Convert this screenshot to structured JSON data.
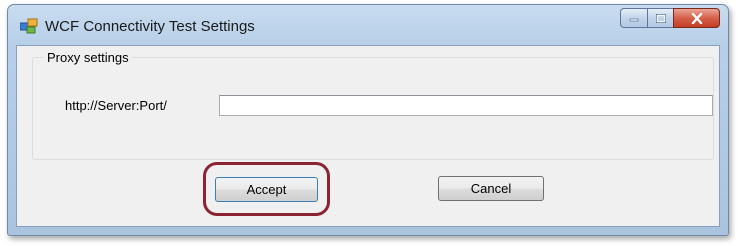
{
  "window": {
    "title": "WCF Connectivity Test Settings",
    "controls": {
      "minimize": "minimize",
      "maximize": "maximize",
      "close": "close"
    },
    "close_color": "#c23e25"
  },
  "proxy": {
    "group_label": "Proxy settings",
    "url_label": "http://Server:Port/",
    "url_value": "",
    "url_placeholder": ""
  },
  "buttons": {
    "accept": "Accept",
    "cancel": "Cancel"
  },
  "highlight_color": "#8b2333"
}
